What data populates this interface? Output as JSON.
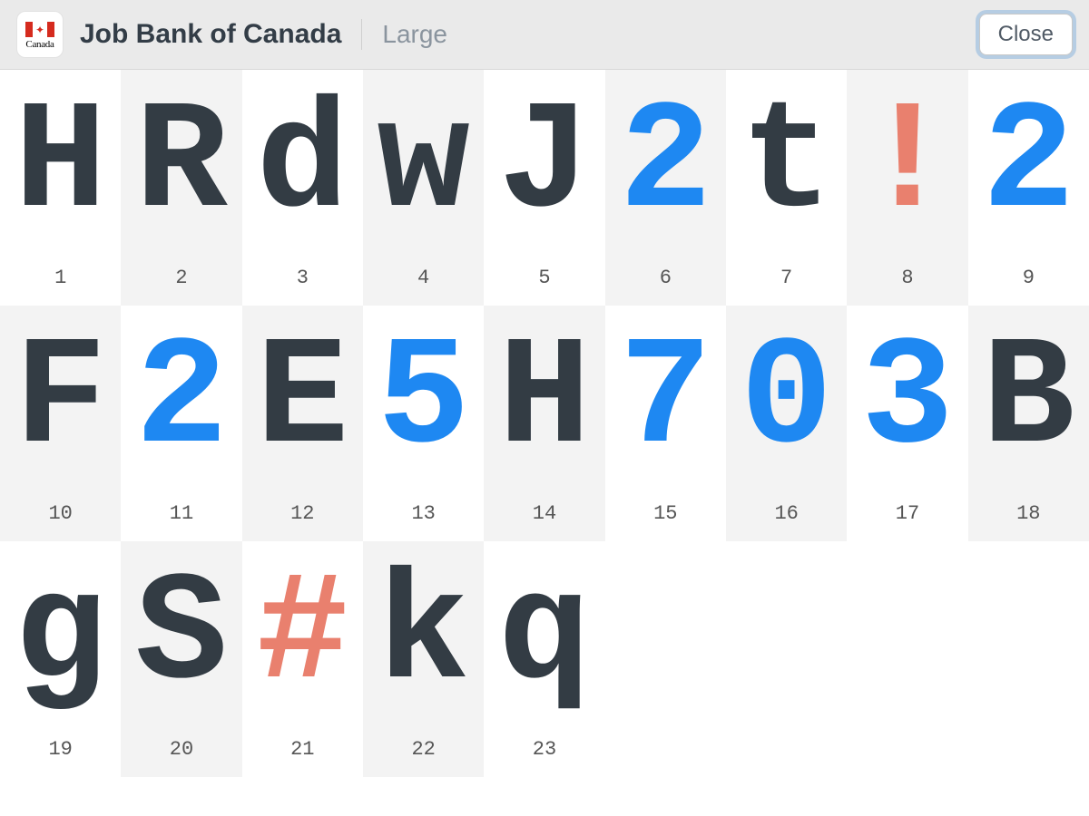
{
  "header": {
    "title": "Job Bank of Canada",
    "subtitle": "Large",
    "close_label": "Close",
    "wordmark": "Canada"
  },
  "colors": {
    "letter": "#333c44",
    "digit": "#1e88f2",
    "symbol": "#e9806e"
  },
  "cells": [
    {
      "index": "1",
      "char": "H",
      "kind": "letter"
    },
    {
      "index": "2",
      "char": "R",
      "kind": "letter"
    },
    {
      "index": "3",
      "char": "d",
      "kind": "letter"
    },
    {
      "index": "4",
      "char": "w",
      "kind": "letter"
    },
    {
      "index": "5",
      "char": "J",
      "kind": "letter"
    },
    {
      "index": "6",
      "char": "2",
      "kind": "digit"
    },
    {
      "index": "7",
      "char": "t",
      "kind": "letter"
    },
    {
      "index": "8",
      "char": "!",
      "kind": "symbol"
    },
    {
      "index": "9",
      "char": "2",
      "kind": "digit"
    },
    {
      "index": "10",
      "char": "F",
      "kind": "letter"
    },
    {
      "index": "11",
      "char": "2",
      "kind": "digit"
    },
    {
      "index": "12",
      "char": "E",
      "kind": "letter"
    },
    {
      "index": "13",
      "char": "5",
      "kind": "digit"
    },
    {
      "index": "14",
      "char": "H",
      "kind": "letter"
    },
    {
      "index": "15",
      "char": "7",
      "kind": "digit"
    },
    {
      "index": "16",
      "char": "0",
      "kind": "digit"
    },
    {
      "index": "17",
      "char": "3",
      "kind": "digit"
    },
    {
      "index": "18",
      "char": "B",
      "kind": "letter"
    },
    {
      "index": "19",
      "char": "g",
      "kind": "letter"
    },
    {
      "index": "20",
      "char": "S",
      "kind": "letter"
    },
    {
      "index": "21",
      "char": "#",
      "kind": "symbol"
    },
    {
      "index": "22",
      "char": "k",
      "kind": "letter"
    },
    {
      "index": "23",
      "char": "q",
      "kind": "letter"
    }
  ]
}
